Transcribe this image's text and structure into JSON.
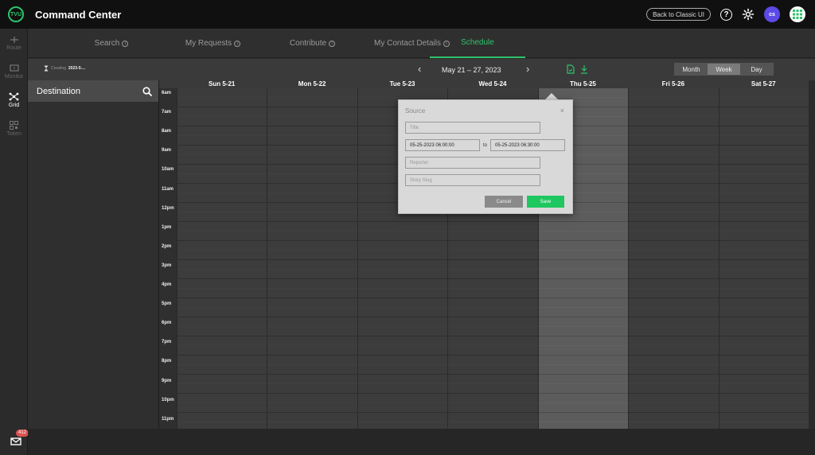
{
  "app": {
    "logo_text": "TVU",
    "title": "Command Center"
  },
  "header": {
    "classic_button": "Back to Classic UI",
    "avatar_initials": "cs"
  },
  "rail": {
    "items": [
      {
        "label": "Route",
        "icon": "route-icon"
      },
      {
        "label": "Monitor",
        "icon": "monitor-icon"
      },
      {
        "label": "Grid",
        "icon": "grid-network-icon"
      },
      {
        "label": "Token",
        "icon": "qr-token-icon"
      }
    ],
    "mail_badge": "412"
  },
  "tabs": [
    {
      "label": "Search"
    },
    {
      "label": "My Requests"
    },
    {
      "label": "Contribute"
    },
    {
      "label": "My Contact Details"
    },
    {
      "label": "Schedule"
    }
  ],
  "toolbar": {
    "creating_label": "Creating",
    "creating_value": "2023-5-...",
    "date_range": "May 21 – 27, 2023",
    "views": [
      "Month",
      "Week",
      "Day"
    ],
    "active_view": "Week"
  },
  "destination": {
    "title": "Destination"
  },
  "calendar": {
    "days": [
      "Sun 5-21",
      "Mon 5-22",
      "Tue 5-23",
      "Wed 5-24",
      "Thu 5-25",
      "Fri 5-26",
      "Sat 5-27"
    ],
    "hours": [
      "6am",
      "7am",
      "8am",
      "9am",
      "10am",
      "11am",
      "12pm",
      "1pm",
      "2pm",
      "3pm",
      "4pm",
      "5pm",
      "6pm",
      "7pm",
      "8pm",
      "9pm",
      "10pm",
      "11pm"
    ],
    "today_index": 4
  },
  "popup": {
    "title": "Source",
    "close": "×",
    "title_placeholder": "Title",
    "start": "05-25-2023 06:00:00",
    "to": "to",
    "end": "05-25-2023 06:30:00",
    "reporter_placeholder": "Reporter",
    "slug_placeholder": "Story Slug",
    "cancel": "Cancel",
    "save": "Save"
  }
}
